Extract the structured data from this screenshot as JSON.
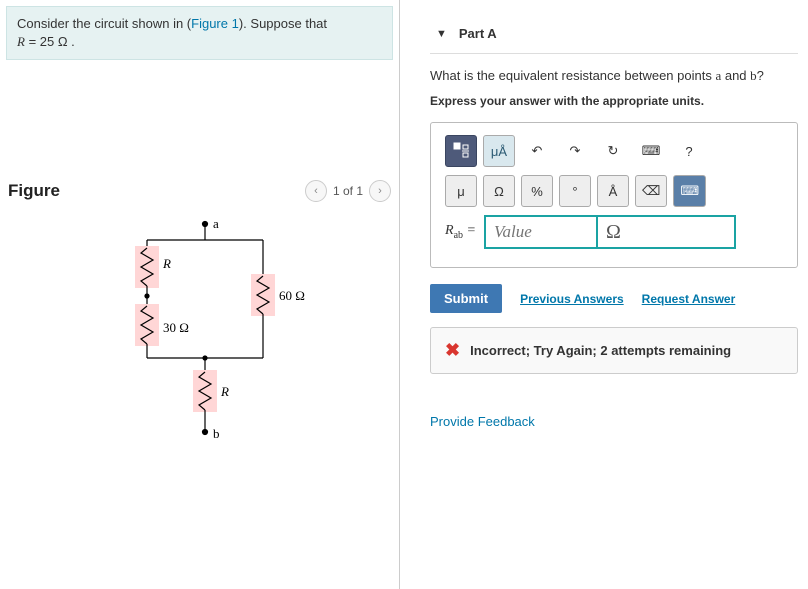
{
  "prompt": {
    "pre": "Consider the circuit shown in (",
    "figlink": "Figure 1",
    "post": "). Suppose that",
    "eq_lhs": "R",
    "eq_rhs": " = 25 Ω ."
  },
  "figure": {
    "title": "Figure",
    "pager": "1 of 1",
    "labels": {
      "a": "a",
      "b": "b",
      "R1": "R",
      "R2": "30 Ω",
      "R3": "60 Ω",
      "R4": "R"
    }
  },
  "part": {
    "label": "Part A",
    "question_pre": "What is the equivalent resistance between points ",
    "q_a": "a",
    "q_mid": " and ",
    "q_b": "b",
    "q_end": "?",
    "instruct": "Express your answer with the appropriate units."
  },
  "toolbar": {
    "row1": {
      "templates": "▭",
      "units_highlight": "μÅ",
      "undo": "↶",
      "redo": "↷",
      "reset": "↻",
      "keyboard": "⌨",
      "help": "?"
    },
    "row2": {
      "mu": "μ",
      "omega": "Ω",
      "percent": "%",
      "degree": "°",
      "angstrom": "Å",
      "backspace": "⌫",
      "kbd2": "⌨"
    }
  },
  "answer": {
    "var_html": "R",
    "var_sub": "ab",
    "eq": " = ",
    "placeholder": "Value",
    "unit": "Ω"
  },
  "actions": {
    "submit": "Submit",
    "prev": "Previous Answers",
    "request": "Request Answer"
  },
  "feedback": {
    "icon": "✖",
    "text": "Incorrect; Try Again; 2 attempts remaining"
  },
  "provide_feedback": "Provide Feedback"
}
